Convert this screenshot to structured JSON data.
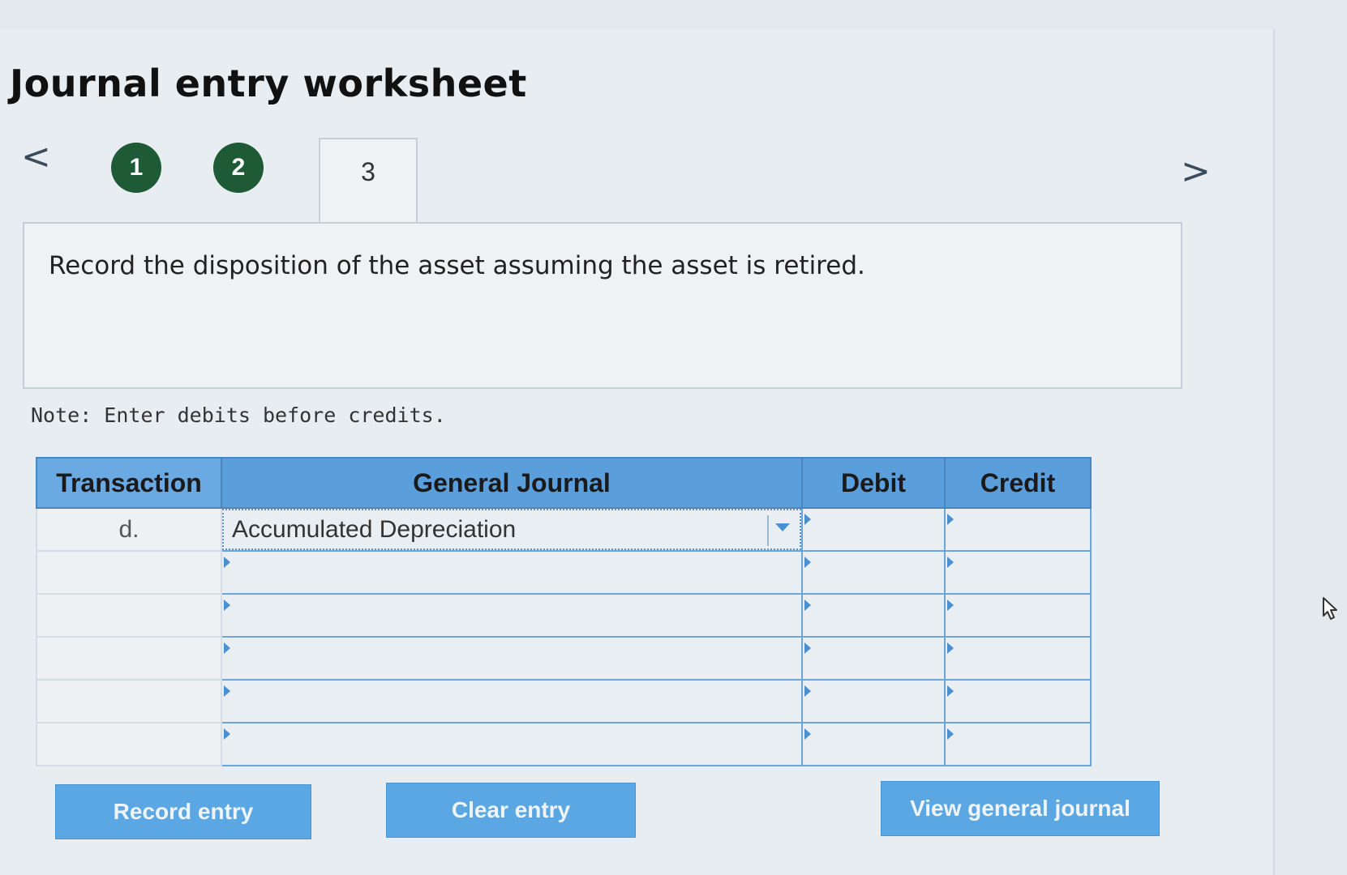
{
  "header": {
    "title": "Journal entry worksheet"
  },
  "nav": {
    "prev_symbol": "<",
    "next_symbol": ">",
    "steps": [
      {
        "label": "1",
        "state": "completed"
      },
      {
        "label": "2",
        "state": "completed"
      },
      {
        "label": "3",
        "state": "active"
      }
    ]
  },
  "prompt": {
    "text": "Record the disposition of the asset assuming the asset is retired."
  },
  "note": "Note: Enter debits before credits.",
  "table": {
    "columns": [
      "Transaction",
      "General Journal",
      "Debit",
      "Credit"
    ],
    "rows": [
      {
        "transaction": "d.",
        "account": "Accumulated Depreciation",
        "debit": "",
        "credit": ""
      },
      {
        "transaction": "",
        "account": "",
        "debit": "",
        "credit": ""
      },
      {
        "transaction": "",
        "account": "",
        "debit": "",
        "credit": ""
      },
      {
        "transaction": "",
        "account": "",
        "debit": "",
        "credit": ""
      },
      {
        "transaction": "",
        "account": "",
        "debit": "",
        "credit": ""
      },
      {
        "transaction": "",
        "account": "",
        "debit": "",
        "credit": ""
      }
    ]
  },
  "buttons": {
    "record": "Record entry",
    "clear": "Clear entry",
    "view": "View general journal"
  },
  "colors": {
    "accent": "#5aa7e3",
    "step_completed": "#1f5a36",
    "header_bg": "#5a9fdc"
  },
  "icons": {
    "prev": "chevron-left-icon",
    "next": "chevron-right-icon",
    "dropdown": "caret-down-icon",
    "cursor": "mouse-pointer-icon"
  }
}
